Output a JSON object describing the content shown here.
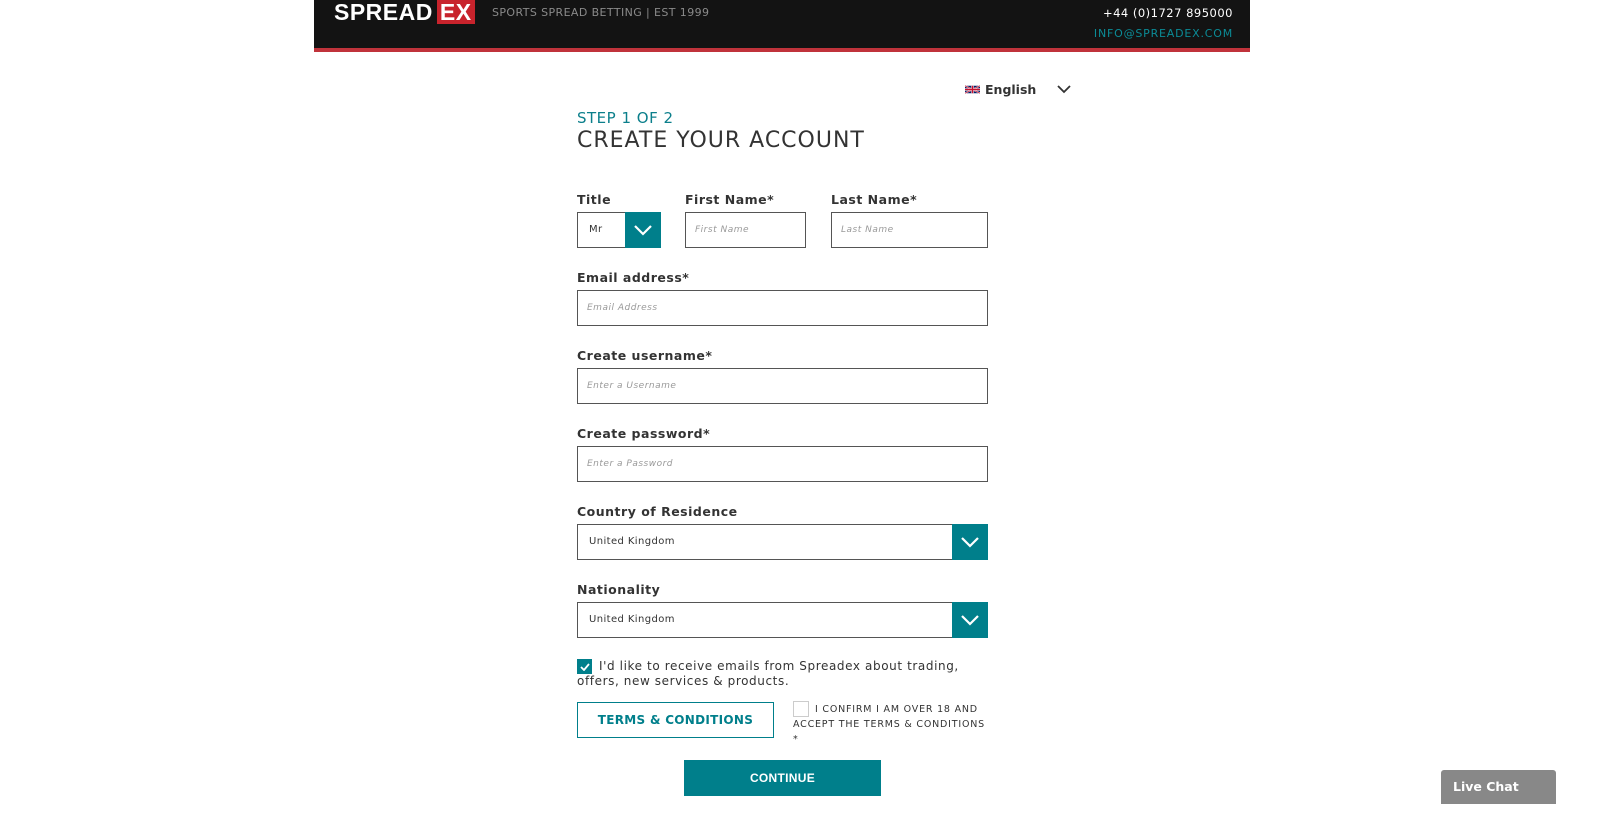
{
  "header": {
    "logo_main": "SPREAD",
    "logo_accent": "EX",
    "tagline": "SPORTS SPREAD BETTING | EST 1999",
    "phone": "+44 (0)1727 895000",
    "email": "INFO@SPREADEX.COM"
  },
  "language": {
    "selected": "English",
    "icon": "uk-flag-icon"
  },
  "form": {
    "step": "STEP 1 OF 2",
    "title": "CREATE YOUR ACCOUNT",
    "title_field": {
      "label": "Title",
      "value": "Mr"
    },
    "first_name": {
      "label": "First Name*",
      "placeholder": "First Name"
    },
    "last_name": {
      "label": "Last Name*",
      "placeholder": "Last Name"
    },
    "email": {
      "label": "Email address*",
      "placeholder": "Email Address"
    },
    "username": {
      "label": "Create username*",
      "placeholder": "Enter a Username"
    },
    "password": {
      "label": "Create password*",
      "placeholder": "Enter a Password"
    },
    "country": {
      "label": "Country of Residence",
      "value": "United Kingdom"
    },
    "nationality": {
      "label": "Nationality",
      "value": "United Kingdom"
    },
    "marketing": {
      "label": "I'd like to receive emails from Spreadex about trading, offers, new services & products.",
      "checked": true
    },
    "terms_button": "TERMS & CONDITIONS",
    "confirm": {
      "label": "I CONFIRM I AM OVER 18 AND ACCEPT THE TERMS & CONDITIONS *",
      "checked": false
    },
    "continue": "CONTINUE"
  },
  "live_chat": "Live Chat",
  "colors": {
    "accent": "#007f8b",
    "brand_red": "#c8232c",
    "header_bg": "#131313"
  }
}
